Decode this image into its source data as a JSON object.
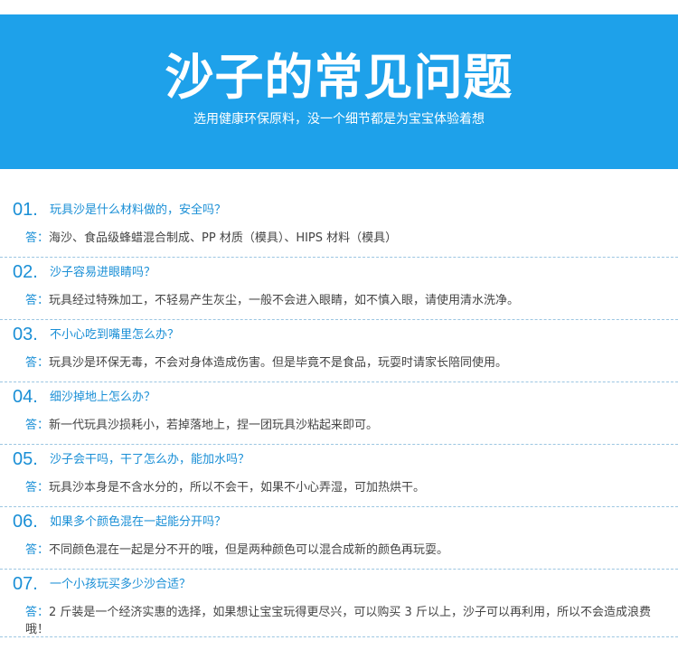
{
  "banner": {
    "title": "沙子的常见问题",
    "subtitle": "选用健康环保原料，没一个细节都是为宝宝体验着想"
  },
  "answer_label": "答：",
  "faq": [
    {
      "number": "01.",
      "question": "玩具沙是什么材料做的，安全吗？",
      "answer": "海沙、食品级蜂蜡混合制成、PP 材质（模具）、HIPS 材料（模具）"
    },
    {
      "number": "02.",
      "question": "沙子容易进眼睛吗？",
      "answer": "玩具经过特殊加工，不轻易产生灰尘，一般不会进入眼睛，如不慎入眼，请使用清水洗净。"
    },
    {
      "number": "03.",
      "question": "不小心吃到嘴里怎么办？",
      "answer": "玩具沙是环保无毒，不会对身体造成伤害。但是毕竟不是食品，玩耍时请家长陪同使用。"
    },
    {
      "number": "04.",
      "question": "细沙掉地上怎么办？",
      "answer": "新一代玩具沙损耗小，若掉落地上，捏一团玩具沙粘起来即可。"
    },
    {
      "number": "05.",
      "question": "沙子会干吗，干了怎么办，能加水吗？",
      "answer": "玩具沙本身是不含水分的，所以不会干，如果不小心弄湿，可加热烘干。"
    },
    {
      "number": "06.",
      "question": "如果多个颜色混在一起能分开吗？",
      "answer": "不同颜色混在一起是分不开的哦，但是两种颜色可以混合成新的颜色再玩耍。"
    },
    {
      "number": "07.",
      "question": "一个小孩玩买多少沙合适？",
      "answer": "2 斤装是一个经济实惠的选择，如果想让宝宝玩得更尽兴，可以购买 3 斤以上，沙子可以再利用，所以不会造成浪费哦！"
    }
  ],
  "colors": {
    "banner_bg": "#1ea1ea",
    "accent": "#1a8fd6",
    "body_text": "#444444",
    "divider": "#9cc6e2"
  }
}
